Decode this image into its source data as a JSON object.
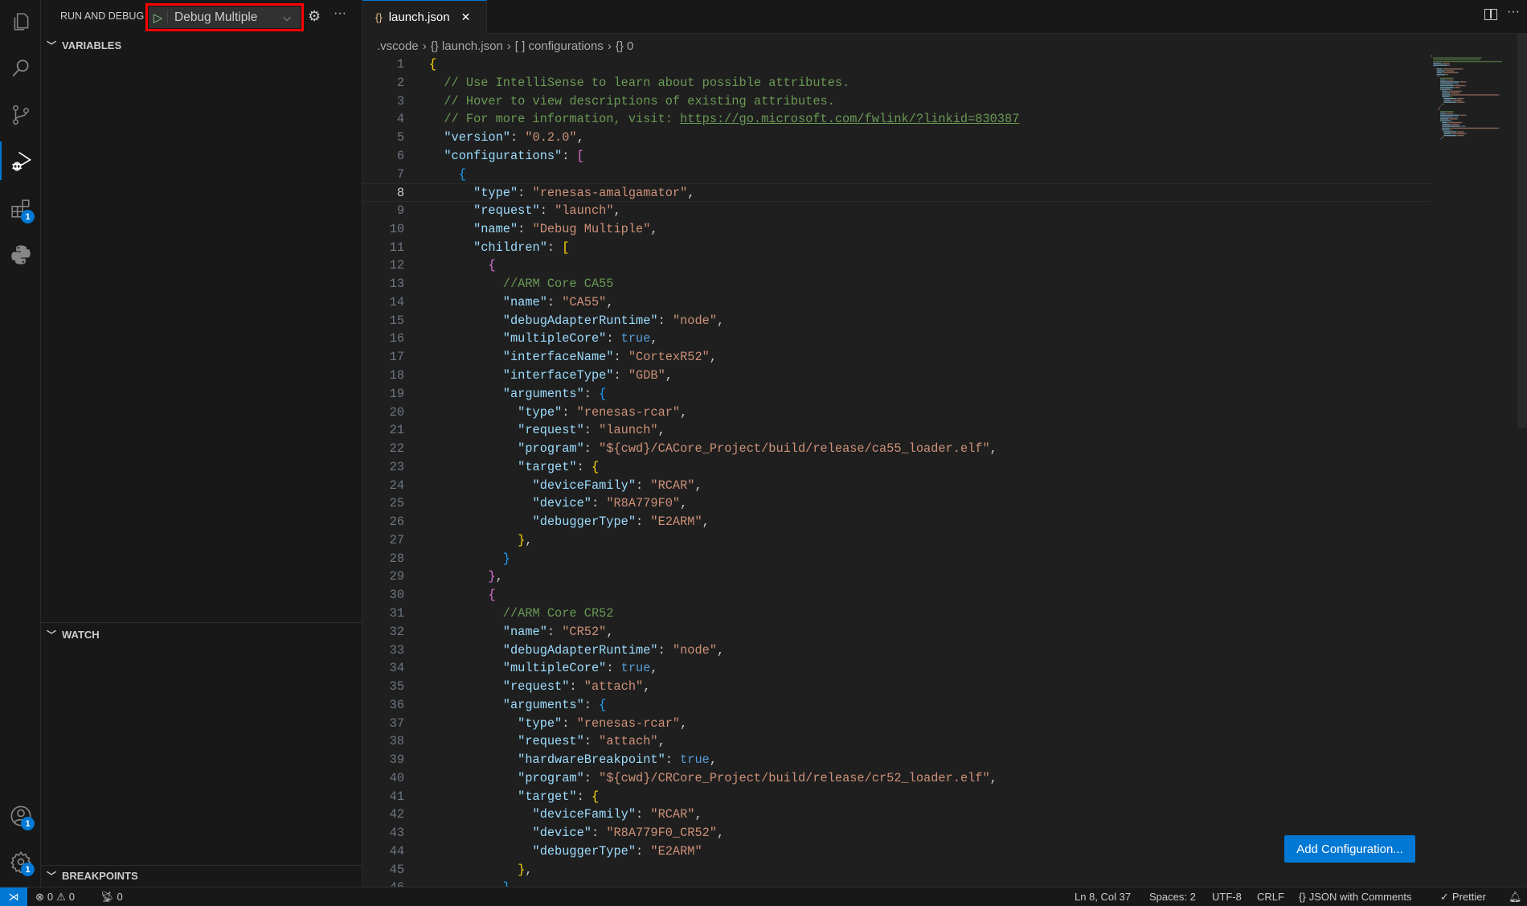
{
  "activity_bar": {
    "extensions_badge": "1",
    "accounts_badge": "1",
    "manage_badge": "1"
  },
  "sidebar": {
    "title": "RUN AND DEBUG",
    "config_select": "Debug Multiple",
    "sections": {
      "variables": "VARIABLES",
      "watch": "WATCH",
      "breakpoints": "BREAKPOINTS"
    }
  },
  "editor": {
    "tab": {
      "icon": "{}",
      "label": "launch.json",
      "close": "✕"
    },
    "breadcrumb": [
      ".vscode",
      "{} launch.json",
      "[ ] configurations",
      "{} 0"
    ],
    "current_line": 8,
    "lines": [
      [
        [
          "g",
          "{"
        ]
      ],
      [
        [
          "p",
          "  "
        ],
        [
          "c",
          "// Use IntelliSense to learn about possible attributes."
        ]
      ],
      [
        [
          "p",
          "  "
        ],
        [
          "c",
          "// Hover to view descriptions of existing attributes."
        ]
      ],
      [
        [
          "p",
          "  "
        ],
        [
          "c",
          "// For more information, visit: "
        ],
        [
          "l",
          "https://go.microsoft.com/fwlink/?linkid=830387"
        ]
      ],
      [
        [
          "p",
          "  "
        ],
        [
          "k",
          "\"version\""
        ],
        [
          "p",
          ": "
        ],
        [
          "s",
          "\"0.2.0\""
        ],
        [
          "p",
          ","
        ]
      ],
      [
        [
          "p",
          "  "
        ],
        [
          "k",
          "\"configurations\""
        ],
        [
          "p",
          ": "
        ],
        [
          "m",
          "["
        ]
      ],
      [
        [
          "p",
          "    "
        ],
        [
          "u",
          "{"
        ]
      ],
      [
        [
          "p",
          "      "
        ],
        [
          "k",
          "\"type\""
        ],
        [
          "p",
          ": "
        ],
        [
          "s",
          "\"renesas-amalgamator\""
        ],
        [
          "p",
          ","
        ]
      ],
      [
        [
          "p",
          "      "
        ],
        [
          "k",
          "\"request\""
        ],
        [
          "p",
          ": "
        ],
        [
          "s",
          "\"launch\""
        ],
        [
          "p",
          ","
        ]
      ],
      [
        [
          "p",
          "      "
        ],
        [
          "k",
          "\"name\""
        ],
        [
          "p",
          ": "
        ],
        [
          "s",
          "\"Debug Multiple\""
        ],
        [
          "p",
          ","
        ]
      ],
      [
        [
          "p",
          "      "
        ],
        [
          "k",
          "\"children\""
        ],
        [
          "p",
          ": "
        ],
        [
          "g",
          "["
        ]
      ],
      [
        [
          "p",
          "        "
        ],
        [
          "m",
          "{"
        ]
      ],
      [
        [
          "p",
          "          "
        ],
        [
          "c",
          "//ARM Core CA55"
        ]
      ],
      [
        [
          "p",
          "          "
        ],
        [
          "k",
          "\"name\""
        ],
        [
          "p",
          ": "
        ],
        [
          "s",
          "\"CA55\""
        ],
        [
          "p",
          ","
        ]
      ],
      [
        [
          "p",
          "          "
        ],
        [
          "k",
          "\"debugAdapterRuntime\""
        ],
        [
          "p",
          ": "
        ],
        [
          "s",
          "\"node\""
        ],
        [
          "p",
          ","
        ]
      ],
      [
        [
          "p",
          "          "
        ],
        [
          "k",
          "\"multipleCore\""
        ],
        [
          "p",
          ": "
        ],
        [
          "b",
          "true"
        ],
        [
          "p",
          ","
        ]
      ],
      [
        [
          "p",
          "          "
        ],
        [
          "k",
          "\"interfaceName\""
        ],
        [
          "p",
          ": "
        ],
        [
          "s",
          "\"CortexR52\""
        ],
        [
          "p",
          ","
        ]
      ],
      [
        [
          "p",
          "          "
        ],
        [
          "k",
          "\"interfaceType\""
        ],
        [
          "p",
          ": "
        ],
        [
          "s",
          "\"GDB\""
        ],
        [
          "p",
          ","
        ]
      ],
      [
        [
          "p",
          "          "
        ],
        [
          "k",
          "\"arguments\""
        ],
        [
          "p",
          ": "
        ],
        [
          "u",
          "{"
        ]
      ],
      [
        [
          "p",
          "            "
        ],
        [
          "k",
          "\"type\""
        ],
        [
          "p",
          ": "
        ],
        [
          "s",
          "\"renesas-rcar\""
        ],
        [
          "p",
          ","
        ]
      ],
      [
        [
          "p",
          "            "
        ],
        [
          "k",
          "\"request\""
        ],
        [
          "p",
          ": "
        ],
        [
          "s",
          "\"launch\""
        ],
        [
          "p",
          ","
        ]
      ],
      [
        [
          "p",
          "            "
        ],
        [
          "k",
          "\"program\""
        ],
        [
          "p",
          ": "
        ],
        [
          "s",
          "\"${cwd}/CACore_Project/build/release/ca55_loader.elf\""
        ],
        [
          "p",
          ","
        ]
      ],
      [
        [
          "p",
          "            "
        ],
        [
          "k",
          "\"target\""
        ],
        [
          "p",
          ": "
        ],
        [
          "g",
          "{"
        ]
      ],
      [
        [
          "p",
          "              "
        ],
        [
          "k",
          "\"deviceFamily\""
        ],
        [
          "p",
          ": "
        ],
        [
          "s",
          "\"RCAR\""
        ],
        [
          "p",
          ","
        ]
      ],
      [
        [
          "p",
          "              "
        ],
        [
          "k",
          "\"device\""
        ],
        [
          "p",
          ": "
        ],
        [
          "s",
          "\"R8A779F0\""
        ],
        [
          "p",
          ","
        ]
      ],
      [
        [
          "p",
          "              "
        ],
        [
          "k",
          "\"debuggerType\""
        ],
        [
          "p",
          ": "
        ],
        [
          "s",
          "\"E2ARM\""
        ],
        [
          "p",
          ","
        ]
      ],
      [
        [
          "p",
          "            "
        ],
        [
          "g",
          "}"
        ],
        [
          "p",
          ","
        ]
      ],
      [
        [
          "p",
          "          "
        ],
        [
          "u",
          "}"
        ]
      ],
      [
        [
          "p",
          "        "
        ],
        [
          "m",
          "}"
        ],
        [
          "p",
          ","
        ]
      ],
      [
        [
          "p",
          "        "
        ],
        [
          "m",
          "{"
        ]
      ],
      [
        [
          "p",
          "          "
        ],
        [
          "c",
          "//ARM Core CR52"
        ]
      ],
      [
        [
          "p",
          "          "
        ],
        [
          "k",
          "\"name\""
        ],
        [
          "p",
          ": "
        ],
        [
          "s",
          "\"CR52\""
        ],
        [
          "p",
          ","
        ]
      ],
      [
        [
          "p",
          "          "
        ],
        [
          "k",
          "\"debugAdapterRuntime\""
        ],
        [
          "p",
          ": "
        ],
        [
          "s",
          "\"node\""
        ],
        [
          "p",
          ","
        ]
      ],
      [
        [
          "p",
          "          "
        ],
        [
          "k",
          "\"multipleCore\""
        ],
        [
          "p",
          ": "
        ],
        [
          "b",
          "true"
        ],
        [
          "p",
          ","
        ]
      ],
      [
        [
          "p",
          "          "
        ],
        [
          "k",
          "\"request\""
        ],
        [
          "p",
          ": "
        ],
        [
          "s",
          "\"attach\""
        ],
        [
          "p",
          ","
        ]
      ],
      [
        [
          "p",
          "          "
        ],
        [
          "k",
          "\"arguments\""
        ],
        [
          "p",
          ": "
        ],
        [
          "u",
          "{"
        ]
      ],
      [
        [
          "p",
          "            "
        ],
        [
          "k",
          "\"type\""
        ],
        [
          "p",
          ": "
        ],
        [
          "s",
          "\"renesas-rcar\""
        ],
        [
          "p",
          ","
        ]
      ],
      [
        [
          "p",
          "            "
        ],
        [
          "k",
          "\"request\""
        ],
        [
          "p",
          ": "
        ],
        [
          "s",
          "\"attach\""
        ],
        [
          "p",
          ","
        ]
      ],
      [
        [
          "p",
          "            "
        ],
        [
          "k",
          "\"hardwareBreakpoint\""
        ],
        [
          "p",
          ": "
        ],
        [
          "b",
          "true"
        ],
        [
          "p",
          ","
        ]
      ],
      [
        [
          "p",
          "            "
        ],
        [
          "k",
          "\"program\""
        ],
        [
          "p",
          ": "
        ],
        [
          "s",
          "\"${cwd}/CRCore_Project/build/release/cr52_loader.elf\""
        ],
        [
          "p",
          ","
        ]
      ],
      [
        [
          "p",
          "            "
        ],
        [
          "k",
          "\"target\""
        ],
        [
          "p",
          ": "
        ],
        [
          "g",
          "{"
        ]
      ],
      [
        [
          "p",
          "              "
        ],
        [
          "k",
          "\"deviceFamily\""
        ],
        [
          "p",
          ": "
        ],
        [
          "s",
          "\"RCAR\""
        ],
        [
          "p",
          ","
        ]
      ],
      [
        [
          "p",
          "              "
        ],
        [
          "k",
          "\"device\""
        ],
        [
          "p",
          ": "
        ],
        [
          "s",
          "\"R8A779F0_CR52\""
        ],
        [
          "p",
          ","
        ]
      ],
      [
        [
          "p",
          "              "
        ],
        [
          "k",
          "\"debuggerType\""
        ],
        [
          "p",
          ": "
        ],
        [
          "s",
          "\"E2ARM\""
        ]
      ],
      [
        [
          "p",
          "            "
        ],
        [
          "g",
          "}"
        ],
        [
          "p",
          ","
        ]
      ],
      [
        [
          "p",
          "          "
        ],
        [
          "u",
          "}"
        ]
      ]
    ],
    "add_configuration": "Add Configuration..."
  },
  "status_bar": {
    "errors": "0",
    "warnings": "0",
    "ports": "0",
    "position": "Ln 8, Col 37",
    "spaces": "Spaces: 2",
    "encoding": "UTF-8",
    "eol": "CRLF",
    "language": "JSON with Comments",
    "formatter": "Prettier"
  },
  "colors": {
    "accent": "#0078d4",
    "highlight_box": "#ff0000",
    "key": "#9cdcfe",
    "string": "#ce9178",
    "comment": "#6a9955",
    "keyword": "#569cd6"
  }
}
